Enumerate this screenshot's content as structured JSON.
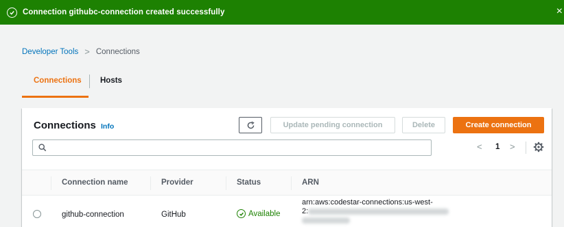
{
  "flash": {
    "message": "Connection githubc-connection created successfully",
    "close": "×",
    "color": "#1d8102"
  },
  "breadcrumb": {
    "parent": "Developer Tools",
    "separator": ">",
    "current": "Connections"
  },
  "tabs": [
    {
      "label": "Connections",
      "active": true
    },
    {
      "label": "Hosts",
      "active": false
    }
  ],
  "panel": {
    "title": "Connections",
    "info_label": "Info",
    "refresh_icon": "refresh-icon",
    "buttons": {
      "update": "Update pending connection",
      "delete": "Delete",
      "create": "Create connection"
    },
    "search": {
      "placeholder": "",
      "value": ""
    },
    "pagination": {
      "prev": "<",
      "page": "1",
      "next": ">"
    }
  },
  "table": {
    "columns": [
      "Connection name",
      "Provider",
      "Status",
      "ARN"
    ],
    "rows": [
      {
        "name": "github-connection",
        "provider": "GitHub",
        "status": "Available",
        "arn_line1": "arn:aws:codestar-connections:us-west-",
        "arn_line2": "2:"
      }
    ]
  },
  "colors": {
    "accent": "#ec7211",
    "link": "#0073bb",
    "success": "#1d8102"
  }
}
